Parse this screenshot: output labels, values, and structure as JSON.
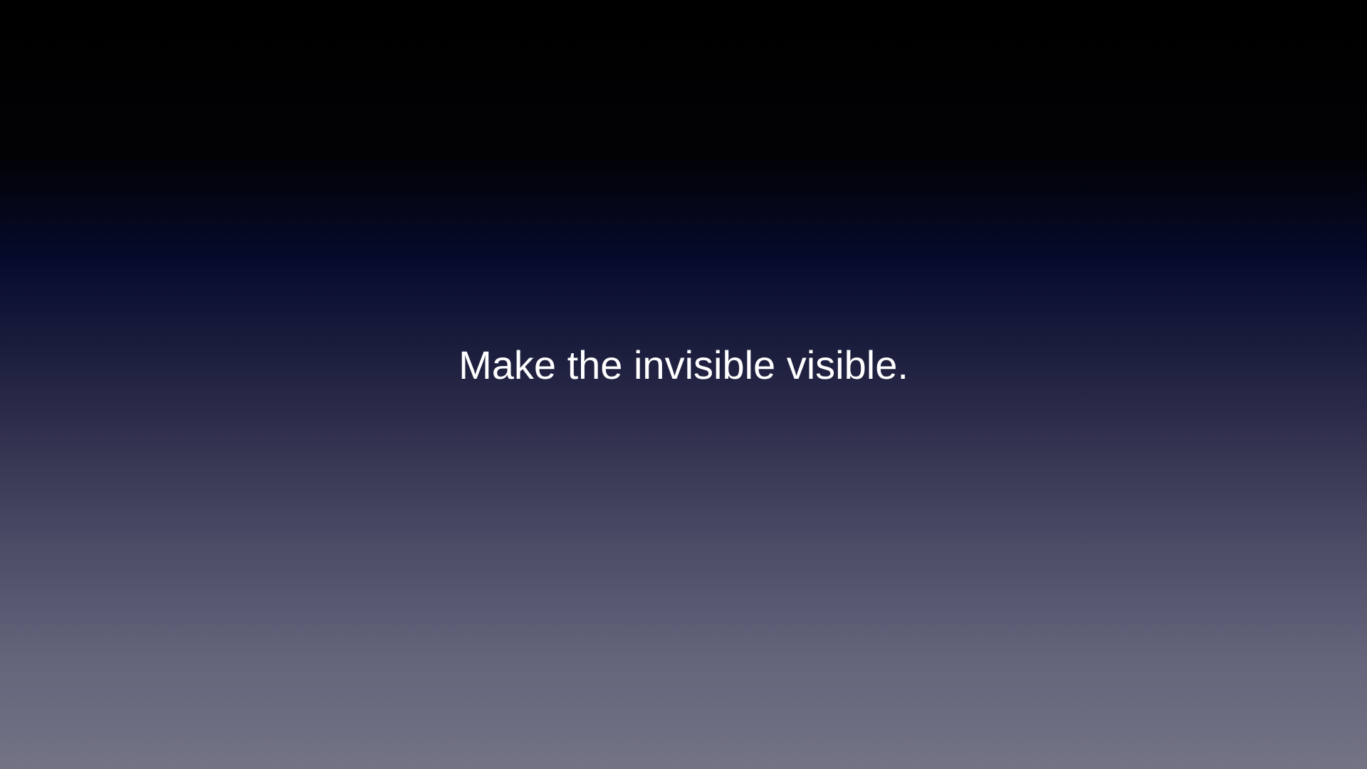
{
  "slide": {
    "headline": "Make the invisible visible.",
    "colors": {
      "background_top": "#000000",
      "background_mid": "#060a2a",
      "background_bottom": "#737385",
      "text": "#ffffff"
    }
  }
}
